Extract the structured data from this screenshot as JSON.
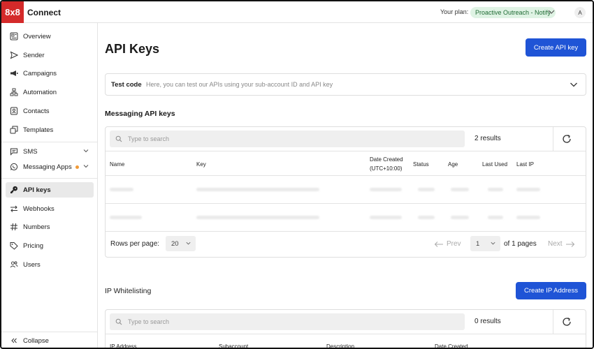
{
  "brand": {
    "logo_text": "8x8",
    "app_name": "Connect",
    "color": "#d42a2a"
  },
  "topbar": {
    "plan_label": "Your plan:",
    "plan_name": "Proactive Outreach - Notify",
    "avatar_initial": "A"
  },
  "sidebar": {
    "items": [
      {
        "label": "Overview",
        "icon": "overview-icon"
      },
      {
        "label": "Sender",
        "icon": "send-icon"
      },
      {
        "label": "Campaigns",
        "icon": "megaphone-icon"
      },
      {
        "label": "Automation",
        "icon": "automation-icon"
      },
      {
        "label": "Contacts",
        "icon": "contacts-icon"
      },
      {
        "label": "Templates",
        "icon": "templates-icon"
      },
      {
        "label": "SMS",
        "icon": "chat-icon"
      },
      {
        "label": "Messaging Apps",
        "icon": "whatsapp-icon"
      },
      {
        "label": "API keys",
        "icon": "key-icon",
        "active": true
      },
      {
        "label": "Webhooks",
        "icon": "webhooks-icon"
      },
      {
        "label": "Numbers",
        "icon": "hash-icon"
      },
      {
        "label": "Pricing",
        "icon": "tag-icon"
      },
      {
        "label": "Users",
        "icon": "users-icon"
      }
    ],
    "collapse_label": "Collapse"
  },
  "main": {
    "title": "API Keys",
    "create_api_key_label": "Create API key",
    "test_code": {
      "label": "Test code",
      "description": "Here, you can test our APIs using your sub-account ID and API key"
    },
    "messaging": {
      "title": "Messaging API keys",
      "search_placeholder": "Type to search",
      "results": "2 results",
      "columns": [
        "Name",
        "Key",
        "Date Created",
        "(UTC+10:00)",
        "Status",
        "Age",
        "Last Used",
        "Last IP"
      ],
      "rows_per_page_label": "Rows per page:",
      "rows_per_page": "20",
      "prev_label": "Prev",
      "page": "1",
      "of_pages": "of 1 pages",
      "next_label": "Next"
    },
    "ip": {
      "title": "IP Whitelisting",
      "create_label": "Create IP Address",
      "search_placeholder": "Type to search",
      "results": "0 results",
      "columns": [
        "IP Address",
        "Subaccount",
        "Description",
        "Date Created"
      ]
    }
  },
  "colors": {
    "primary": "#1f54d6",
    "badge_bg": "#dff3e4",
    "badge_text": "#1f6b34",
    "status_dot": "#f19a36"
  }
}
